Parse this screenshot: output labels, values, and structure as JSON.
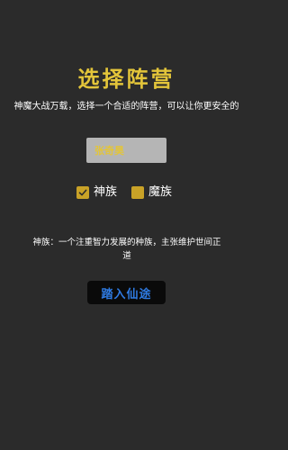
{
  "page": {
    "title": "选择阵营",
    "subtitle": "神魔大战万载，选择一个合适的阵营，可以让你更安全的",
    "name_input": {
      "value": "张奇昊"
    },
    "factions": [
      {
        "label": "神族",
        "checked": true
      },
      {
        "label": "魔族",
        "checked": false
      }
    ],
    "description": "神族：一个注重智力发展的种族，主张维护世间正道",
    "enter_button_label": "踏入仙途"
  },
  "colors": {
    "background": "#2b2b2b",
    "title": "#e3c53a",
    "checkbox": "#c9a227",
    "input_bg": "#b5b5b5",
    "button_bg": "#0a0a0a",
    "button_text": "#2f7be3"
  }
}
